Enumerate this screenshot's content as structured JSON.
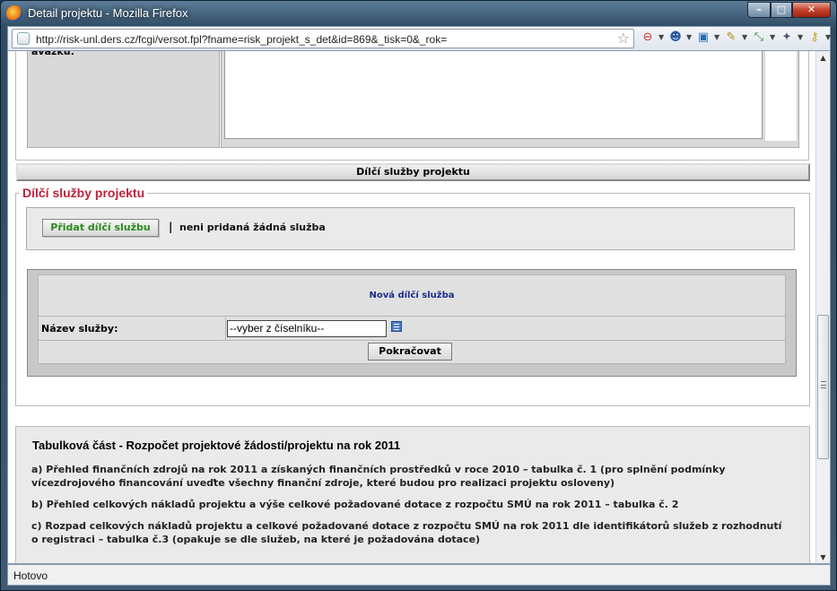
{
  "window": {
    "title": "Detail projektu - Mozilla Firefox",
    "controls": {
      "minimize": "–",
      "maximize": "□",
      "close": "✕"
    }
  },
  "navbar": {
    "url": "http://risk-unl.ders.cz/fcgi/versot.fpl?fname=risk_projekt_s_det&id=869&_tisk=0&_rok=",
    "icons": [
      "globe-icon",
      "bookmark-star-icon",
      "stop-icon",
      "user-icon",
      "translate-icon",
      "brush-icon",
      "resize-icon",
      "tools-icon",
      "key-icon"
    ]
  },
  "top_section": {
    "label": "ávazku:"
  },
  "collapse_bar": {
    "label": "Dílčí služby projektu"
  },
  "subservices": {
    "legend": "Dílčí služby projektu",
    "add_button": "Přidat dílčí službu",
    "separator": "|",
    "empty_text": "neni pridaná žádná služba",
    "new_form": {
      "title": "Nová dílčí služba",
      "name_label": "Název služby:",
      "name_value": "--vyber z číselníku--",
      "continue_button": "Pokračovat"
    }
  },
  "tabular": {
    "heading": "Tabulková část - Rozpočet projektové žádosti/projektu na rok 2011",
    "items": [
      "a) Přehled finančních zdrojů na rok 2011 a získaných finančních prostředků v roce 2010 – tabulka č. 1 (pro splnění podmínky vícezdrojového financování uveďte všechny finanční zdroje, které budou pro realizaci projektu osloveny)",
      "b) Přehled celkových nákladů projektu a výše celkové požadované dotace z rozpočtu SMÚ na rok 2011 – tabulka č. 2",
      "c) Rozpad celkových nákladů projektu a celkové požadované dotace z rozpočtu SMÚ na rok 2011 dle identifikátorů služeb z rozhodnutí o registraci – tabulka č.3 (opakuje se dle služeb, na které je požadována dotace)"
    ]
  },
  "statusbar": {
    "text": "Hotovo"
  }
}
